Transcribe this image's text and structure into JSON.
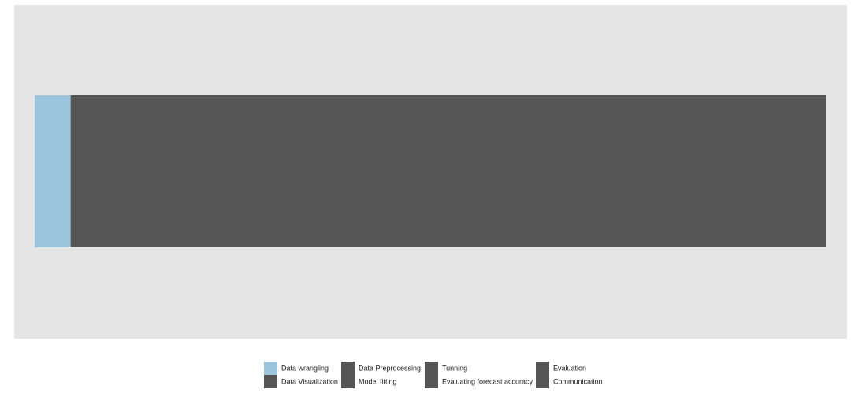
{
  "chart_data": {
    "type": "bar",
    "orientation": "horizontal-stacked",
    "title": "",
    "xlabel": "",
    "ylabel": "",
    "grid": false,
    "legend_position": "bottom",
    "series": [
      {
        "name": "Data wrangling",
        "value": 1,
        "color": "#9ac5dc"
      },
      {
        "name": "Data Visualization",
        "value": 0,
        "color": "#555555"
      },
      {
        "name": "Data Preprocessing",
        "value": 0,
        "color": "#555555"
      },
      {
        "name": "Model fitting",
        "value": 0,
        "color": "#555555"
      },
      {
        "name": "Tunning",
        "value": 0,
        "color": "#555555"
      },
      {
        "name": "Evaluating forecast accuracy",
        "value": 0,
        "color": "#555555"
      },
      {
        "name": "Evaluation",
        "value": 0,
        "color": "#555555"
      },
      {
        "name": "Communication",
        "value": 21,
        "color": "#555555"
      }
    ],
    "legend_rows": [
      [
        "Data wrangling",
        "Data Preprocessing",
        "Tunning",
        "Evaluation"
      ],
      [
        "Data Visualization",
        "Model fitting",
        "Evaluating forecast accuracy",
        "Communication"
      ]
    ]
  },
  "colors": {
    "panel_background": "#e5e5e5",
    "highlight": "#9ac5dc",
    "muted": "#555555"
  }
}
